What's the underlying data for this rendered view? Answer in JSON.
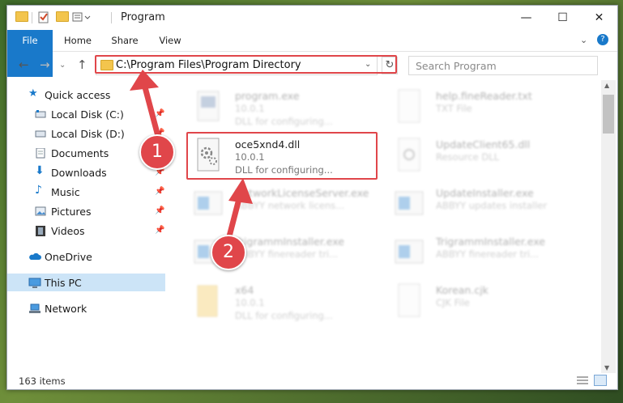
{
  "window": {
    "title": "Program",
    "controls": {
      "minimize": "—",
      "maximize": "☐",
      "close": "✕"
    }
  },
  "ribbon": {
    "tabs": [
      {
        "label": "File"
      },
      {
        "label": "Home"
      },
      {
        "label": "Share"
      },
      {
        "label": "View"
      }
    ]
  },
  "nav": {
    "address": "C:\\Program Files\\Program Directory",
    "search_placeholder": "Search Program"
  },
  "sidebar": {
    "items": [
      {
        "label": "Quick access"
      },
      {
        "label": "Local Disk (C:)"
      },
      {
        "label": "Local Disk (D:)"
      },
      {
        "label": "Documents"
      },
      {
        "label": "Downloads"
      },
      {
        "label": "Music"
      },
      {
        "label": "Pictures"
      },
      {
        "label": "Videos"
      },
      {
        "label": "OneDrive"
      },
      {
        "label": "This PC"
      },
      {
        "label": "Network"
      }
    ]
  },
  "files": [
    {
      "name": "program.exe",
      "line2": "10.0.1",
      "line3": "DLL for configuring..."
    },
    {
      "name": "help.fineReader.txt",
      "line2": "TXT File",
      "line3": ""
    },
    {
      "name": "oce5xnd4.dll",
      "line2": "10.0.1",
      "line3": "DLL for configuring..."
    },
    {
      "name": "UpdateClient65.dll",
      "line2": "Resource DLL",
      "line3": ""
    },
    {
      "name": "NetworkLicenseServer.exe",
      "line2": "ABBYY network licens...",
      "line3": ""
    },
    {
      "name": "UpdateInstaller.exe",
      "line2": "ABBYY updates installer",
      "line3": ""
    },
    {
      "name": "TrigrammInstaller.exe",
      "line2": "ABBYY finereader tri...",
      "line3": ""
    },
    {
      "name": "TrigrammInstaller.exe",
      "line2": "ABBYY finereader tri...",
      "line3": ""
    },
    {
      "name": "x64",
      "line2": "10.0.1",
      "line3": "DLL for configuring..."
    },
    {
      "name": "Korean.cjk",
      "line2": "CJK File",
      "line3": ""
    }
  ],
  "status": {
    "item_count": "163 items"
  },
  "annotations": {
    "step1": "1",
    "step2": "2"
  },
  "colors": {
    "accent": "#1979ca",
    "highlight": "#e0464a",
    "selected": "#cce4f7"
  }
}
